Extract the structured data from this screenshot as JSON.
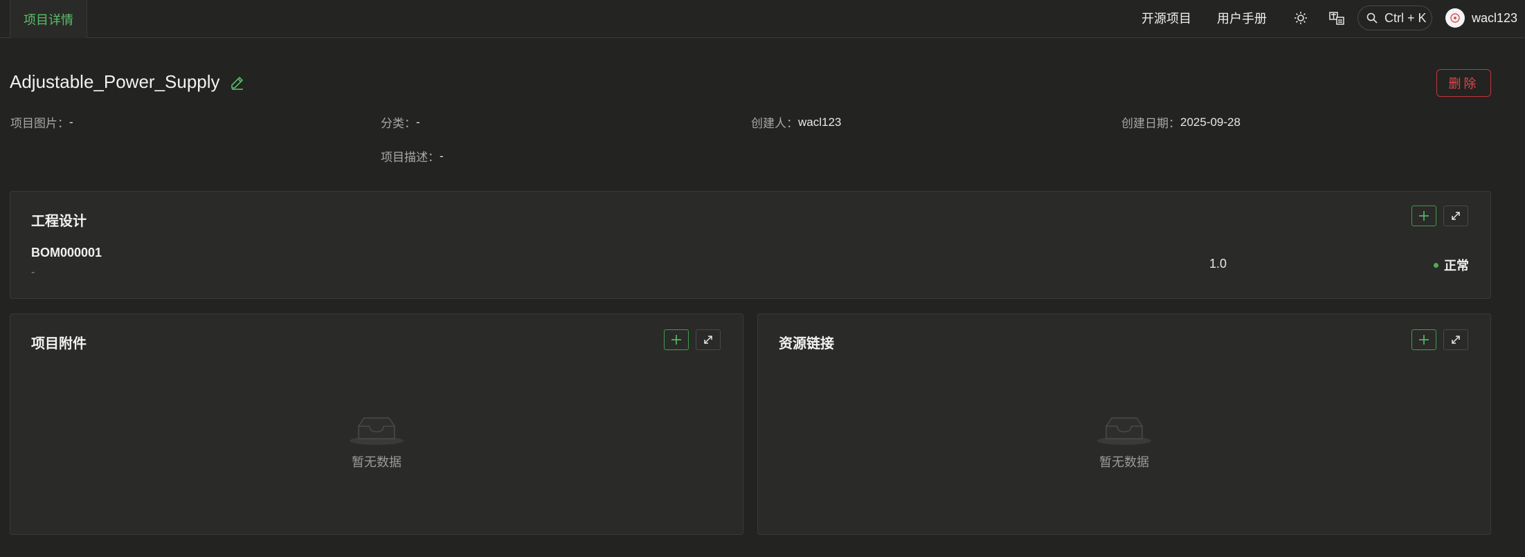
{
  "header": {
    "tab_label": "项目详情",
    "nav": [
      "开源项目",
      "用户手册"
    ],
    "search_label": "Ctrl + K",
    "username": "wacl123"
  },
  "project": {
    "name": "Adjustable_Power_Supply",
    "delete_label": "删除",
    "meta": {
      "image_key": "项目图片：",
      "image_val": "-",
      "category_key": "分类：",
      "category_val": "-",
      "creator_key": "创建人：",
      "creator_val": "wacl123",
      "date_key": "创建日期：",
      "date_val": "2025-09-28",
      "desc_key": "项目描述：",
      "desc_val": "-"
    }
  },
  "engineering": {
    "title": "工程设计",
    "items": [
      {
        "code": "BOM000001",
        "subtitle": "-",
        "version": "1.0",
        "status": "正常"
      }
    ]
  },
  "attachments": {
    "title": "项目附件",
    "empty_text": "暂无数据"
  },
  "resources": {
    "title": "资源链接",
    "empty_text": "暂无数据"
  },
  "colors": {
    "accent": "#5bbf6a",
    "danger": "#e0474c",
    "background": "#232321",
    "card": "#2a2a28"
  }
}
